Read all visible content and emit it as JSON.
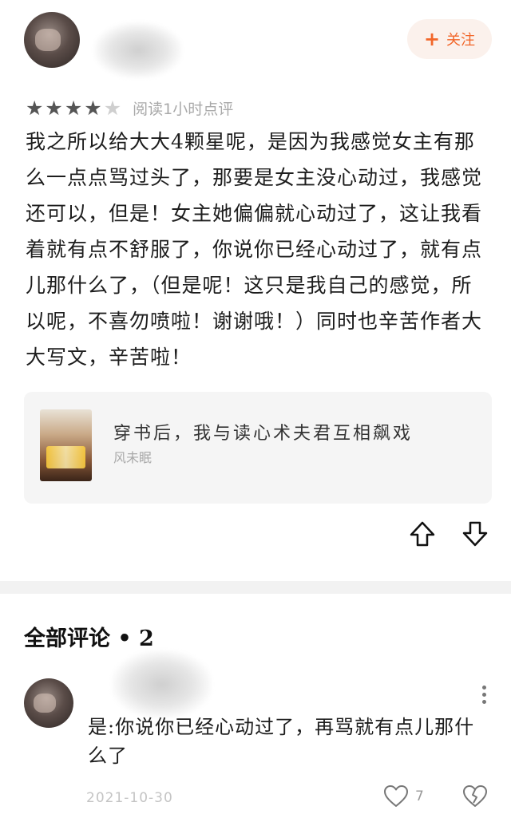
{
  "header": {
    "follow_label": "关注",
    "follow_icon": "plus-icon"
  },
  "review": {
    "rating": 4,
    "rating_max": 5,
    "rating_note": "阅读1小时点评",
    "text": "我之所以给大大4颗星呢，是因为我感觉女主有那么一点点骂过头了，那要是女主没心动过，我感觉还可以，但是！女主她偏偏就心动过了，这让我看着就有点不舒服了，你说你已经心动过了，就有点儿那什么了，（但是呢！这只是我自己的感觉，所以呢，不喜勿喷啦！谢谢哦！）同时也辛苦作者大大写文，辛苦啦！"
  },
  "book": {
    "title": "穿书后，我与读心术夫君互相飙戏",
    "author": "风未眠"
  },
  "actions": {
    "upvote_icon": "arrow-up-icon",
    "downvote_icon": "arrow-down-icon"
  },
  "comments": {
    "heading": "全部评论 • 2",
    "items": [
      {
        "text": "是:你说你已经心动过了，再骂就有点儿那什么了",
        "date": "2021-10-30",
        "likes": "7"
      }
    ]
  },
  "colors": {
    "accent": "#f2672a",
    "star_filled": "#555555",
    "star_empty": "#cfcfcf",
    "muted": "#a9a9a9"
  }
}
